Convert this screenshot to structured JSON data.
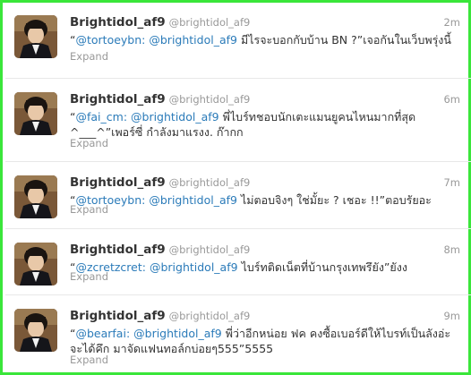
{
  "theme": {
    "frame_color": "#3ae63a",
    "link_color": "#2b7bb9",
    "name_color": "#333333",
    "meta_color": "#999999"
  },
  "tweets": [
    {
      "name": "Brightidol_af9",
      "handle": "@brightidol_af9",
      "time": "2m",
      "mention1": "@tortoeybn:",
      "mention2": "@brightidol_af9",
      "open_quote": "“",
      "body": "มีไรจะบอกกับบ้าน BN ?”เจอกันในเว็บพรุ่งนี้",
      "expand": "Expand",
      "avatar_icon": "profile-photo"
    },
    {
      "name": "Brightidol_af9",
      "handle": "@brightidol_af9",
      "time": "6m",
      "mention1": "@fai_cm:",
      "mention2": "@brightidol_af9",
      "open_quote": "“",
      "body": "พี่ไบร์ทชอบนักเตะแมนยูคนไหนมากที่สุด ^___^”เพอร์ซี่ กำลังมาแรงง. ก๊ากก",
      "expand": "Expand",
      "avatar_icon": "profile-photo"
    },
    {
      "name": "Brightidol_af9",
      "handle": "@brightidol_af9",
      "time": "7m",
      "mention1": "@tortoeybn:",
      "mention2": "@brightidol_af9",
      "open_quote": "“",
      "body": "ไม่ตอบจิงๆ ใช่มั้ยะ ? เชอะ !!”ตอบรัยอะ",
      "expand": "Expand",
      "avatar_icon": "profile-photo"
    },
    {
      "name": "Brightidol_af9",
      "handle": "@brightidol_af9",
      "time": "8m",
      "mention1": "@zcretzcret:",
      "mention2": "@brightidol_af9",
      "open_quote": "“",
      "body": "ไบร์ทติดเน็ตที่บ้านกรุงเทพรึยัง”ยังง",
      "expand": "Expand",
      "avatar_icon": "profile-photo"
    },
    {
      "name": "Brightidol_af9",
      "handle": "@brightidol_af9",
      "time": "9m",
      "mention1": "@bearfai:",
      "mention2": "@brightidol_af9",
      "open_quote": "“",
      "body": "พี่ว่าอีกหน่อย ฟค คงซื้อเบอร์ดีให้ไบรท์เป็นลังอ่ะ จะได้คึก มาจัดแฟนทอล์กบ่อยๆ555”5555",
      "expand": "Expand",
      "avatar_icon": "profile-photo"
    }
  ]
}
